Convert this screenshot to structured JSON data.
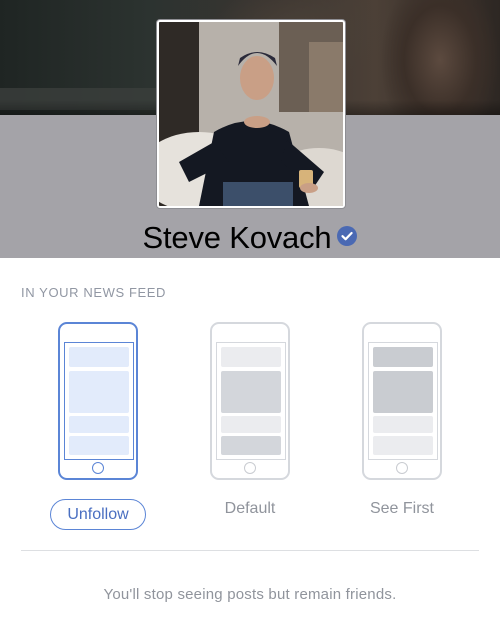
{
  "profile": {
    "name": "Steve Kovach",
    "verified": true
  },
  "feed_settings": {
    "section_title": "IN YOUR NEWS FEED",
    "options": [
      {
        "label": "Unfollow",
        "selected": true
      },
      {
        "label": "Default",
        "selected": false
      },
      {
        "label": "See First",
        "selected": false
      }
    ],
    "description": "You'll stop seeing posts but remain friends."
  },
  "colors": {
    "accent_blue": "#5b85d6",
    "verified_badge": "#4a69b3",
    "muted_text": "#90949c",
    "header_band": "#a4a3a8"
  },
  "icons": {
    "verified": "verified-checkmark-icon",
    "phone": "phone-feed-icon"
  }
}
